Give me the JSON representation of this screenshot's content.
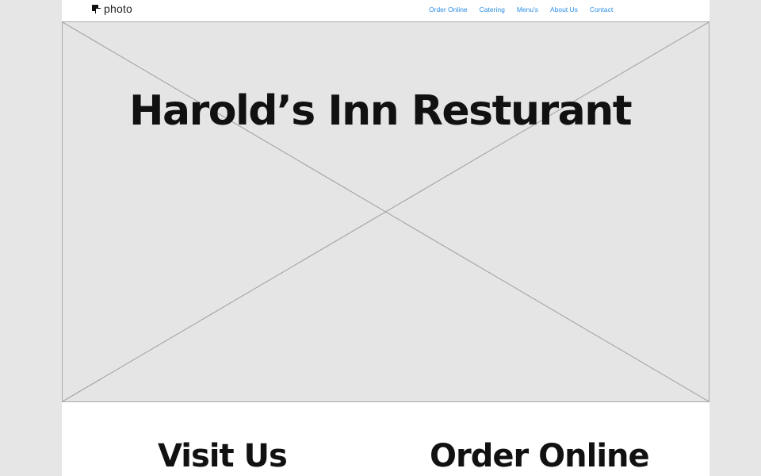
{
  "header": {
    "logo_text": "photo",
    "logo_icon": "stacked-squares-icon",
    "nav": [
      {
        "label": "Order Online"
      },
      {
        "label": "Catering"
      },
      {
        "label": "Menu's"
      },
      {
        "label": "About Us"
      },
      {
        "label": "Contact"
      }
    ]
  },
  "hero": {
    "title": "Harold’s Inn Resturant",
    "image_placeholder": "image-placeholder-x"
  },
  "sections": {
    "visit_heading": "Visit Us",
    "order_heading": "Order Online"
  },
  "colors": {
    "page_background": "#e6e6e6",
    "content_background": "#ffffff",
    "hero_fill": "#e5e5e5",
    "nav_link": "#2a8ee8",
    "heading": "#111111"
  }
}
